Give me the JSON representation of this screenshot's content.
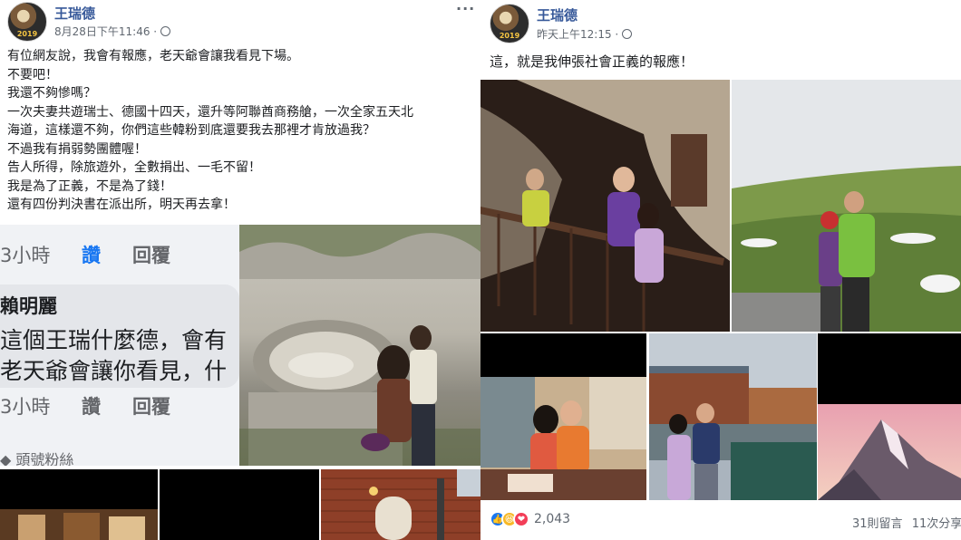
{
  "left_post": {
    "author": "王瑞德",
    "avatar_year": "2019",
    "timestamp": "8月28日下午11:46 ·",
    "text_lines": [
      "有位網友說，我會有報應，老天爺會讓我看見下場。",
      "不要吧！",
      "我還不夠慘嗎？",
      "一次夫妻共遊瑞士、德國十四天，還升等阿聯酋商務艙，一次全家五天北",
      "海道，這樣還不夠，你們這些韓粉到底還要我去那裡才肯放過我？",
      "不過我有捐弱勢團體喔！",
      "告人所得，除旅遊外，全數捐出、一毛不留！",
      "我是為了正義，不是為了錢！",
      "還有四份判決書在派出所，明天再去拿！"
    ],
    "comment": {
      "time1": "3小時",
      "like1": "讚",
      "reply1": "回覆",
      "name": "賴明麗",
      "line1": "這個王瑞什麼德，會有",
      "line2": "老天爺會讓你看見，什",
      "time2": "3小時",
      "like2": "讚",
      "reply2": "回覆",
      "badge": "頭號粉絲"
    }
  },
  "right_post": {
    "author": "王瑞德",
    "avatar_year": "2019",
    "timestamp": "昨天上午12:15 ·",
    "text": "這，就是我伸張社會正義的報應！",
    "reaction_count": "2,043",
    "comments_count": "31則留言",
    "shares_count": "11次分享"
  },
  "colors": {
    "link_blue": "#365899",
    "like_blue": "#1877f2",
    "haha_yellow": "#f7b928",
    "love_red": "#f33e58"
  }
}
